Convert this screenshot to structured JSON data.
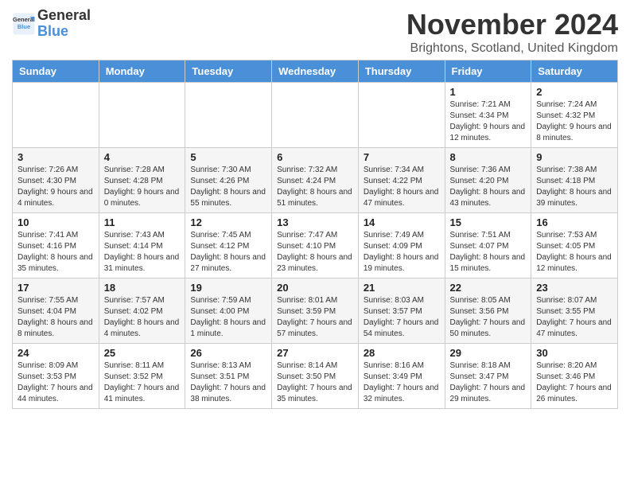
{
  "header": {
    "logo_line1": "General",
    "logo_line2": "Blue",
    "month_title": "November 2024",
    "location": "Brightons, Scotland, United Kingdom"
  },
  "days_of_week": [
    "Sunday",
    "Monday",
    "Tuesday",
    "Wednesday",
    "Thursday",
    "Friday",
    "Saturday"
  ],
  "weeks": [
    [
      {
        "day": "",
        "info": ""
      },
      {
        "day": "",
        "info": ""
      },
      {
        "day": "",
        "info": ""
      },
      {
        "day": "",
        "info": ""
      },
      {
        "day": "",
        "info": ""
      },
      {
        "day": "1",
        "info": "Sunrise: 7:21 AM\nSunset: 4:34 PM\nDaylight: 9 hours and 12 minutes."
      },
      {
        "day": "2",
        "info": "Sunrise: 7:24 AM\nSunset: 4:32 PM\nDaylight: 9 hours and 8 minutes."
      }
    ],
    [
      {
        "day": "3",
        "info": "Sunrise: 7:26 AM\nSunset: 4:30 PM\nDaylight: 9 hours and 4 minutes."
      },
      {
        "day": "4",
        "info": "Sunrise: 7:28 AM\nSunset: 4:28 PM\nDaylight: 9 hours and 0 minutes."
      },
      {
        "day": "5",
        "info": "Sunrise: 7:30 AM\nSunset: 4:26 PM\nDaylight: 8 hours and 55 minutes."
      },
      {
        "day": "6",
        "info": "Sunrise: 7:32 AM\nSunset: 4:24 PM\nDaylight: 8 hours and 51 minutes."
      },
      {
        "day": "7",
        "info": "Sunrise: 7:34 AM\nSunset: 4:22 PM\nDaylight: 8 hours and 47 minutes."
      },
      {
        "day": "8",
        "info": "Sunrise: 7:36 AM\nSunset: 4:20 PM\nDaylight: 8 hours and 43 minutes."
      },
      {
        "day": "9",
        "info": "Sunrise: 7:38 AM\nSunset: 4:18 PM\nDaylight: 8 hours and 39 minutes."
      }
    ],
    [
      {
        "day": "10",
        "info": "Sunrise: 7:41 AM\nSunset: 4:16 PM\nDaylight: 8 hours and 35 minutes."
      },
      {
        "day": "11",
        "info": "Sunrise: 7:43 AM\nSunset: 4:14 PM\nDaylight: 8 hours and 31 minutes."
      },
      {
        "day": "12",
        "info": "Sunrise: 7:45 AM\nSunset: 4:12 PM\nDaylight: 8 hours and 27 minutes."
      },
      {
        "day": "13",
        "info": "Sunrise: 7:47 AM\nSunset: 4:10 PM\nDaylight: 8 hours and 23 minutes."
      },
      {
        "day": "14",
        "info": "Sunrise: 7:49 AM\nSunset: 4:09 PM\nDaylight: 8 hours and 19 minutes."
      },
      {
        "day": "15",
        "info": "Sunrise: 7:51 AM\nSunset: 4:07 PM\nDaylight: 8 hours and 15 minutes."
      },
      {
        "day": "16",
        "info": "Sunrise: 7:53 AM\nSunset: 4:05 PM\nDaylight: 8 hours and 12 minutes."
      }
    ],
    [
      {
        "day": "17",
        "info": "Sunrise: 7:55 AM\nSunset: 4:04 PM\nDaylight: 8 hours and 8 minutes."
      },
      {
        "day": "18",
        "info": "Sunrise: 7:57 AM\nSunset: 4:02 PM\nDaylight: 8 hours and 4 minutes."
      },
      {
        "day": "19",
        "info": "Sunrise: 7:59 AM\nSunset: 4:00 PM\nDaylight: 8 hours and 1 minute."
      },
      {
        "day": "20",
        "info": "Sunrise: 8:01 AM\nSunset: 3:59 PM\nDaylight: 7 hours and 57 minutes."
      },
      {
        "day": "21",
        "info": "Sunrise: 8:03 AM\nSunset: 3:57 PM\nDaylight: 7 hours and 54 minutes."
      },
      {
        "day": "22",
        "info": "Sunrise: 8:05 AM\nSunset: 3:56 PM\nDaylight: 7 hours and 50 minutes."
      },
      {
        "day": "23",
        "info": "Sunrise: 8:07 AM\nSunset: 3:55 PM\nDaylight: 7 hours and 47 minutes."
      }
    ],
    [
      {
        "day": "24",
        "info": "Sunrise: 8:09 AM\nSunset: 3:53 PM\nDaylight: 7 hours and 44 minutes."
      },
      {
        "day": "25",
        "info": "Sunrise: 8:11 AM\nSunset: 3:52 PM\nDaylight: 7 hours and 41 minutes."
      },
      {
        "day": "26",
        "info": "Sunrise: 8:13 AM\nSunset: 3:51 PM\nDaylight: 7 hours and 38 minutes."
      },
      {
        "day": "27",
        "info": "Sunrise: 8:14 AM\nSunset: 3:50 PM\nDaylight: 7 hours and 35 minutes."
      },
      {
        "day": "28",
        "info": "Sunrise: 8:16 AM\nSunset: 3:49 PM\nDaylight: 7 hours and 32 minutes."
      },
      {
        "day": "29",
        "info": "Sunrise: 8:18 AM\nSunset: 3:47 PM\nDaylight: 7 hours and 29 minutes."
      },
      {
        "day": "30",
        "info": "Sunrise: 8:20 AM\nSunset: 3:46 PM\nDaylight: 7 hours and 26 minutes."
      }
    ]
  ]
}
